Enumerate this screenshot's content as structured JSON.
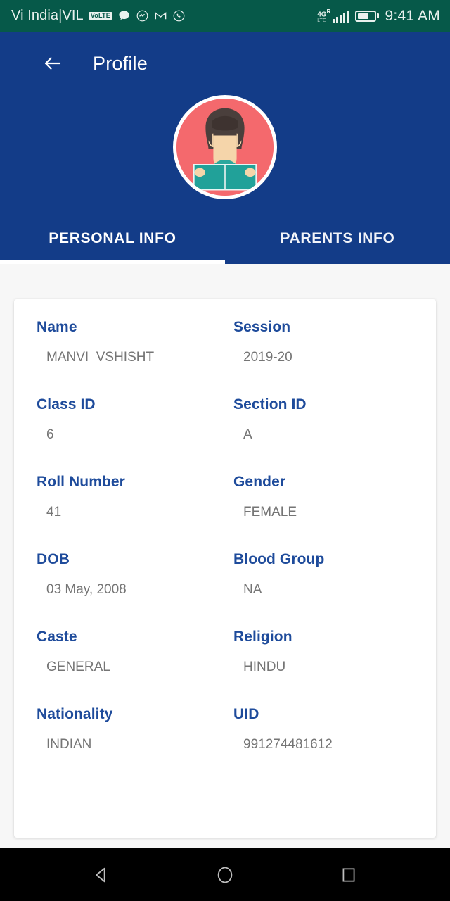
{
  "status_bar": {
    "carrier": "Vi India|VIL",
    "volte_badge": "VoLTE",
    "network_type": "4G",
    "network_roaming": "R",
    "network_sub": "LTE",
    "clock": "9:41 AM",
    "icons": [
      "chat-bubble-icon",
      "messenger-icon",
      "gmail-icon",
      "whatsapp-icon"
    ],
    "bg_color": "#065949"
  },
  "header": {
    "title": "Profile",
    "back_icon": "back-arrow-icon",
    "bg_color": "#133C88",
    "avatar_alt": "student-avatar"
  },
  "tabs": [
    {
      "label": "PERSONAL INFO",
      "active": true
    },
    {
      "label": "PARENTS INFO",
      "active": false
    }
  ],
  "profile": {
    "rows": [
      [
        {
          "label": "Name",
          "value": "MANVI  VSHISHT"
        },
        {
          "label": "Session",
          "value": "2019-20"
        }
      ],
      [
        {
          "label": "Class ID",
          "value": "6"
        },
        {
          "label": "Section ID",
          "value": "A"
        }
      ],
      [
        {
          "label": "Roll Number",
          "value": "41"
        },
        {
          "label": "Gender",
          "value": "FEMALE"
        }
      ],
      [
        {
          "label": "DOB",
          "value": "03 May, 2008"
        },
        {
          "label": "Blood Group",
          "value": "NA"
        }
      ],
      [
        {
          "label": "Caste",
          "value": "GENERAL"
        },
        {
          "label": "Religion",
          "value": "HINDU"
        }
      ],
      [
        {
          "label": "Nationality",
          "value": "INDIAN"
        },
        {
          "label": "UID",
          "value": "991274481612"
        }
      ]
    ],
    "label_color": "#1E4B9B",
    "value_color": "#757575"
  },
  "nav_bar": {
    "back": "nav-back-icon",
    "home": "nav-home-icon",
    "recents": "nav-recents-icon"
  }
}
